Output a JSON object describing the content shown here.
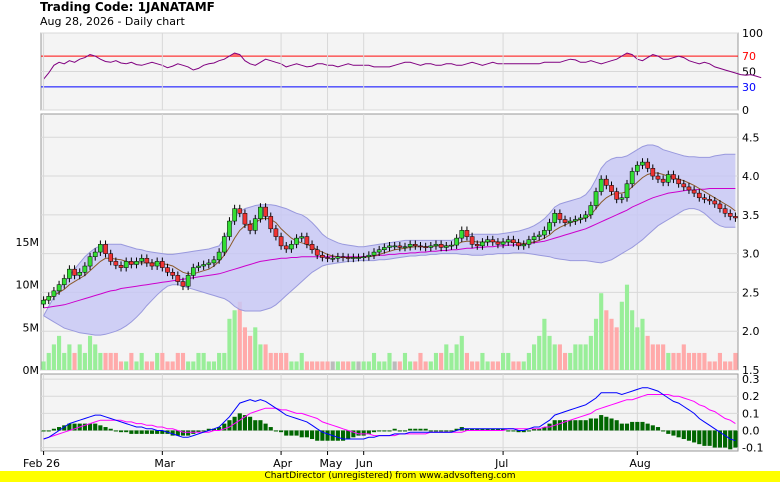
{
  "header": {
    "title": "Trading Code: 1JANATAMF",
    "subtitle": "Aug 28, 2026 - Daily chart"
  },
  "footer": {
    "text": "ChartDirector (unregistered) from www.advsofteng.com"
  },
  "colors": {
    "plot_bg": "#f4f4f4",
    "grid": "#d8d8d8",
    "rsi_line": "#800080",
    "rsi_upper": "#ff0000",
    "rsi_lower": "#0000ff",
    "rsi_fill_high": "#ff6666",
    "bb_fill": "#c8c8f4",
    "bb_edge": "#9999dd",
    "sma_fast": "#8b5a2b",
    "sma_slow": "#cc00cc",
    "candle_up": "#33dd33",
    "candle_down": "#ee3333",
    "volume_up": "#99ee99",
    "volume_down": "#ffaaaa",
    "volume_flat": "#bbbbbb",
    "macd_line": "#0000ff",
    "signal_line": "#ff00ff",
    "hist": "#006600",
    "footer_bg": "#ffff00"
  },
  "chart_data": [
    {
      "panel": "rsi",
      "type": "line",
      "y_ticks": [
        0,
        50,
        100
      ],
      "ylim": [
        0,
        100
      ],
      "reference_lines": [
        {
          "label": "70",
          "value": 70,
          "color": "#ff0000"
        },
        {
          "label": "30",
          "value": 30,
          "color": "#0000ff"
        }
      ],
      "values": [
        40,
        48,
        58,
        62,
        60,
        64,
        62,
        66,
        68,
        72,
        70,
        66,
        63,
        62,
        64,
        61,
        60,
        62,
        59,
        58,
        60,
        62,
        60,
        58,
        55,
        57,
        60,
        58,
        56,
        52,
        54,
        58,
        60,
        61,
        64,
        66,
        70,
        74,
        72,
        64,
        60,
        58,
        62,
        66,
        64,
        62,
        60,
        56,
        58,
        60,
        58,
        56,
        57,
        60,
        60,
        58,
        58,
        56,
        58,
        60,
        58,
        58,
        58,
        58,
        56,
        56,
        56,
        56,
        58,
        60,
        62,
        62,
        60,
        58,
        60,
        60,
        58,
        58,
        60,
        60,
        58,
        58,
        60,
        62,
        60,
        58,
        60,
        62,
        60,
        60,
        60,
        60,
        60,
        60,
        60,
        60,
        60,
        62,
        62,
        62,
        62,
        64,
        66,
        65,
        62,
        62,
        64,
        62,
        60,
        62,
        64,
        66,
        70,
        74,
        72,
        66,
        64,
        68,
        72,
        70,
        66,
        66,
        68,
        70,
        68,
        64,
        62,
        60,
        62,
        60,
        56,
        54,
        52,
        50,
        48,
        46,
        45,
        46,
        44,
        42
      ]
    },
    {
      "panel": "price",
      "type": "candlestick",
      "y_ticks": [
        1.5,
        2.0,
        2.5,
        3.0,
        3.5,
        4.0,
        4.5
      ],
      "ylim": [
        1.5,
        4.8
      ],
      "x_labels": [
        "Feb 26",
        "Mar",
        "Apr",
        "May",
        "Jun",
        "Jul",
        "Aug"
      ],
      "x_label_index": [
        0,
        23,
        46,
        55,
        62,
        89,
        115
      ],
      "volume_ticks": [
        "0M",
        "5M",
        "10M",
        "15M"
      ],
      "volume_tick_values": [
        0,
        5,
        10,
        15
      ],
      "volume_ylim": [
        0,
        30
      ],
      "close": [
        2.4,
        2.45,
        2.52,
        2.6,
        2.68,
        2.8,
        2.72,
        2.76,
        2.84,
        2.96,
        3.02,
        3.12,
        3.0,
        2.9,
        2.85,
        2.82,
        2.9,
        2.86,
        2.9,
        2.94,
        2.88,
        2.84,
        2.9,
        2.82,
        2.76,
        2.72,
        2.64,
        2.58,
        2.72,
        2.82,
        2.84,
        2.86,
        2.88,
        2.92,
        3.02,
        3.22,
        3.42,
        3.58,
        3.52,
        3.38,
        3.3,
        3.45,
        3.6,
        3.48,
        3.32,
        3.22,
        3.1,
        3.06,
        3.12,
        3.2,
        3.22,
        3.12,
        3.05,
        2.98,
        2.95,
        2.94,
        2.94,
        2.96,
        2.95,
        2.94,
        2.95,
        2.95,
        2.96,
        2.98,
        3.02,
        3.05,
        3.08,
        3.1,
        3.1,
        3.08,
        3.09,
        3.12,
        3.1,
        3.09,
        3.08,
        3.1,
        3.12,
        3.08,
        3.1,
        3.11,
        3.2,
        3.3,
        3.22,
        3.12,
        3.1,
        3.15,
        3.18,
        3.15,
        3.12,
        3.15,
        3.18,
        3.14,
        3.1,
        3.12,
        3.18,
        3.22,
        3.24,
        3.3,
        3.4,
        3.52,
        3.44,
        3.4,
        3.42,
        3.44,
        3.46,
        3.5,
        3.62,
        3.8,
        3.96,
        3.88,
        3.8,
        3.7,
        3.72,
        3.9,
        4.06,
        4.14,
        4.18,
        4.1,
        4.0,
        3.96,
        3.92,
        4.02,
        3.96,
        3.9,
        3.86,
        3.82,
        3.78,
        3.72,
        3.7,
        3.68,
        3.64,
        3.58,
        3.52,
        3.48,
        3.46
      ],
      "bb_upper": [
        2.2,
        2.32,
        2.44,
        2.54,
        2.62,
        2.72,
        2.8,
        2.88,
        2.96,
        3.02,
        3.07,
        3.1,
        3.12,
        3.12,
        3.12,
        3.12,
        3.1,
        3.08,
        3.06,
        3.05,
        3.03,
        3.02,
        3.01,
        3.0,
        2.99,
        2.99,
        3.0,
        3.01,
        3.02,
        3.03,
        3.04,
        3.05,
        3.06,
        3.08,
        3.1,
        3.2,
        3.33,
        3.45,
        3.54,
        3.58,
        3.6,
        3.62,
        3.63,
        3.63,
        3.63,
        3.62,
        3.6,
        3.58,
        3.55,
        3.52,
        3.5,
        3.46,
        3.4,
        3.33,
        3.25,
        3.2,
        3.17,
        3.14,
        3.12,
        3.11,
        3.1,
        3.09,
        3.09,
        3.1,
        3.11,
        3.12,
        3.13,
        3.14,
        3.15,
        3.16,
        3.17,
        3.17,
        3.17,
        3.17,
        3.17,
        3.17,
        3.17,
        3.17,
        3.17,
        3.17,
        3.19,
        3.22,
        3.24,
        3.25,
        3.25,
        3.25,
        3.25,
        3.25,
        3.25,
        3.26,
        3.27,
        3.28,
        3.29,
        3.31,
        3.33,
        3.36,
        3.4,
        3.45,
        3.52,
        3.6,
        3.64,
        3.66,
        3.68,
        3.7,
        3.72,
        3.76,
        3.84,
        3.96,
        4.1,
        4.18,
        4.22,
        4.24,
        4.24,
        4.26,
        4.3,
        4.34,
        4.38,
        4.4,
        4.4,
        4.38,
        4.34,
        4.32,
        4.3,
        4.28,
        4.26,
        4.25,
        4.25,
        4.24,
        4.24,
        4.24,
        4.26,
        4.27,
        4.28,
        4.28,
        4.28
      ],
      "bb_lower": [
        2.2,
        2.16,
        2.12,
        2.08,
        2.04,
        2.02,
        2.0,
        1.98,
        1.97,
        1.96,
        1.95,
        1.95,
        1.96,
        1.98,
        2.0,
        2.03,
        2.07,
        2.12,
        2.18,
        2.25,
        2.33,
        2.4,
        2.47,
        2.53,
        2.58,
        2.6,
        2.6,
        2.58,
        2.56,
        2.54,
        2.52,
        2.5,
        2.48,
        2.46,
        2.44,
        2.42,
        2.38,
        2.32,
        2.28,
        2.26,
        2.26,
        2.26,
        2.26,
        2.28,
        2.3,
        2.34,
        2.4,
        2.46,
        2.52,
        2.58,
        2.64,
        2.7,
        2.76,
        2.8,
        2.84,
        2.86,
        2.87,
        2.88,
        2.89,
        2.9,
        2.9,
        2.91,
        2.91,
        2.91,
        2.91,
        2.92,
        2.92,
        2.93,
        2.94,
        2.95,
        2.96,
        2.97,
        2.97,
        2.98,
        2.98,
        2.99,
        2.99,
        3.0,
        3.0,
        3.0,
        3.0,
        2.99,
        2.99,
        2.98,
        2.98,
        2.98,
        2.99,
        2.99,
        3.0,
        3.0,
        3.0,
        3.01,
        3.01,
        3.01,
        3.0,
        2.99,
        2.98,
        2.97,
        2.96,
        2.94,
        2.93,
        2.92,
        2.91,
        2.91,
        2.91,
        2.91,
        2.9,
        2.89,
        2.88,
        2.9,
        2.92,
        2.96,
        3.0,
        3.04,
        3.08,
        3.13,
        3.18,
        3.24,
        3.3,
        3.36,
        3.4,
        3.44,
        3.48,
        3.52,
        3.56,
        3.58,
        3.58,
        3.56,
        3.52,
        3.46,
        3.4,
        3.36,
        3.34,
        3.34,
        3.34
      ],
      "sma_fast": [
        2.4,
        2.42,
        2.46,
        2.5,
        2.54,
        2.6,
        2.64,
        2.68,
        2.72,
        2.78,
        2.84,
        2.9,
        2.94,
        2.94,
        2.93,
        2.92,
        2.9,
        2.88,
        2.88,
        2.88,
        2.88,
        2.88,
        2.88,
        2.87,
        2.86,
        2.84,
        2.8,
        2.76,
        2.74,
        2.74,
        2.76,
        2.78,
        2.8,
        2.84,
        2.9,
        2.98,
        3.08,
        3.2,
        3.3,
        3.36,
        3.38,
        3.4,
        3.44,
        3.46,
        3.44,
        3.4,
        3.32,
        3.26,
        3.2,
        3.16,
        3.14,
        3.12,
        3.09,
        3.05,
        3.02,
        2.99,
        2.97,
        2.96,
        2.95,
        2.95,
        2.95,
        2.95,
        2.95,
        2.96,
        2.97,
        2.99,
        3.01,
        3.03,
        3.05,
        3.06,
        3.07,
        3.08,
        3.09,
        3.09,
        3.09,
        3.09,
        3.1,
        3.1,
        3.1,
        3.1,
        3.12,
        3.15,
        3.16,
        3.16,
        3.15,
        3.15,
        3.15,
        3.16,
        3.15,
        3.15,
        3.15,
        3.15,
        3.14,
        3.13,
        3.14,
        3.15,
        3.17,
        3.2,
        3.24,
        3.3,
        3.34,
        3.37,
        3.4,
        3.42,
        3.44,
        3.46,
        3.5,
        3.58,
        3.66,
        3.72,
        3.76,
        3.78,
        3.78,
        3.8,
        3.86,
        3.92,
        3.98,
        4.02,
        4.04,
        4.04,
        4.02,
        4.0,
        3.98,
        3.96,
        3.94,
        3.91,
        3.88,
        3.84,
        3.8,
        3.76,
        3.72,
        3.68,
        3.64,
        3.6,
        3.55
      ],
      "sma_slow": [
        2.3,
        2.31,
        2.32,
        2.33,
        2.34,
        2.36,
        2.38,
        2.4,
        2.42,
        2.44,
        2.46,
        2.48,
        2.5,
        2.52,
        2.53,
        2.55,
        2.56,
        2.57,
        2.58,
        2.59,
        2.6,
        2.61,
        2.62,
        2.63,
        2.64,
        2.65,
        2.66,
        2.67,
        2.68,
        2.69,
        2.7,
        2.71,
        2.72,
        2.73,
        2.74,
        2.76,
        2.78,
        2.8,
        2.82,
        2.84,
        2.86,
        2.88,
        2.9,
        2.91,
        2.92,
        2.93,
        2.94,
        2.94,
        2.95,
        2.95,
        2.96,
        2.96,
        2.96,
        2.96,
        2.96,
        2.96,
        2.96,
        2.96,
        2.96,
        2.96,
        2.96,
        2.96,
        2.96,
        2.97,
        2.97,
        2.98,
        2.98,
        2.99,
        2.99,
        3.0,
        3.0,
        3.01,
        3.01,
        3.02,
        3.02,
        3.03,
        3.03,
        3.04,
        3.04,
        3.05,
        3.05,
        3.06,
        3.07,
        3.07,
        3.08,
        3.08,
        3.09,
        3.09,
        3.1,
        3.1,
        3.11,
        3.11,
        3.12,
        3.12,
        3.13,
        3.14,
        3.15,
        3.16,
        3.18,
        3.2,
        3.22,
        3.24,
        3.26,
        3.28,
        3.3,
        3.32,
        3.35,
        3.38,
        3.41,
        3.44,
        3.47,
        3.5,
        3.53,
        3.56,
        3.6,
        3.63,
        3.66,
        3.69,
        3.72,
        3.74,
        3.76,
        3.78,
        3.79,
        3.8,
        3.81,
        3.82,
        3.82,
        3.83,
        3.83,
        3.84,
        3.84,
        3.84,
        3.84,
        3.84,
        3.84
      ],
      "volume": [
        1,
        2,
        3,
        4,
        2,
        3,
        2,
        3,
        2,
        4,
        3,
        2,
        2,
        2,
        2,
        1,
        1,
        2,
        1,
        2,
        1,
        1,
        2,
        2,
        1,
        1,
        2,
        2,
        1,
        1,
        2,
        2,
        1,
        1,
        2,
        2,
        6,
        7,
        8,
        5,
        4,
        5,
        3,
        3,
        2,
        2,
        2,
        2,
        1,
        1,
        2,
        1,
        1,
        1,
        1,
        1,
        1,
        1,
        1,
        1,
        1,
        1,
        1,
        1,
        2,
        1,
        1,
        2,
        1,
        1,
        2,
        1,
        1,
        2,
        1,
        1,
        2,
        2,
        3,
        2,
        3,
        4,
        2,
        1,
        1,
        2,
        1,
        1,
        1,
        2,
        2,
        1,
        1,
        1,
        2,
        3,
        4,
        6,
        4,
        3,
        3,
        2,
        2,
        3,
        3,
        3,
        4,
        6,
        9,
        7,
        6,
        5,
        8,
        10,
        7,
        5,
        6,
        4,
        3,
        3,
        3,
        2,
        2,
        2,
        3,
        2,
        2,
        2,
        2,
        1,
        1,
        2,
        1,
        1,
        2
      ]
    },
    {
      "panel": "macd",
      "type": "line",
      "y_ticks": [
        -0.1,
        0.0,
        0.1,
        0.2,
        0.3
      ],
      "ylim": [
        -0.12,
        0.33
      ],
      "macd": [
        -0.05,
        -0.04,
        -0.02,
        0.0,
        0.02,
        0.04,
        0.05,
        0.06,
        0.07,
        0.08,
        0.09,
        0.09,
        0.08,
        0.07,
        0.06,
        0.05,
        0.04,
        0.03,
        0.02,
        0.02,
        0.01,
        0.01,
        0.0,
        0.0,
        -0.01,
        -0.02,
        -0.03,
        -0.04,
        -0.04,
        -0.03,
        -0.02,
        -0.01,
        0.0,
        0.01,
        0.02,
        0.05,
        0.08,
        0.12,
        0.16,
        0.17,
        0.18,
        0.17,
        0.18,
        0.17,
        0.15,
        0.13,
        0.11,
        0.09,
        0.08,
        0.07,
        0.06,
        0.05,
        0.03,
        0.01,
        -0.01,
        -0.02,
        -0.03,
        -0.04,
        -0.05,
        -0.05,
        -0.05,
        -0.05,
        -0.05,
        -0.04,
        -0.04,
        -0.03,
        -0.03,
        -0.03,
        -0.02,
        -0.02,
        -0.02,
        -0.01,
        -0.01,
        -0.01,
        -0.01,
        -0.01,
        -0.01,
        -0.01,
        -0.01,
        -0.01,
        0.0,
        0.01,
        0.01,
        0.01,
        0.01,
        0.01,
        0.01,
        0.01,
        0.01,
        0.01,
        0.01,
        0.01,
        0.0,
        0.0,
        0.01,
        0.02,
        0.02,
        0.04,
        0.06,
        0.09,
        0.1,
        0.11,
        0.12,
        0.13,
        0.14,
        0.15,
        0.17,
        0.19,
        0.22,
        0.22,
        0.22,
        0.22,
        0.21,
        0.22,
        0.23,
        0.24,
        0.25,
        0.25,
        0.24,
        0.23,
        0.21,
        0.19,
        0.17,
        0.16,
        0.14,
        0.12,
        0.1,
        0.07,
        0.05,
        0.03,
        0.01,
        -0.01,
        -0.03,
        -0.05,
        -0.06
      ],
      "signal": [
        -0.05,
        -0.04,
        -0.03,
        -0.02,
        -0.01,
        0.0,
        0.01,
        0.02,
        0.03,
        0.04,
        0.05,
        0.06,
        0.06,
        0.06,
        0.06,
        0.06,
        0.05,
        0.05,
        0.04,
        0.04,
        0.03,
        0.03,
        0.02,
        0.02,
        0.01,
        0.01,
        0.0,
        -0.01,
        -0.01,
        -0.01,
        -0.01,
        -0.01,
        -0.01,
        0.0,
        0.0,
        0.01,
        0.02,
        0.04,
        0.06,
        0.08,
        0.1,
        0.11,
        0.12,
        0.13,
        0.13,
        0.13,
        0.12,
        0.12,
        0.11,
        0.1,
        0.1,
        0.09,
        0.08,
        0.07,
        0.05,
        0.04,
        0.03,
        0.02,
        0.01,
        0.0,
        -0.01,
        -0.02,
        -0.02,
        -0.02,
        -0.03,
        -0.03,
        -0.03,
        -0.03,
        -0.03,
        -0.02,
        -0.02,
        -0.02,
        -0.02,
        -0.02,
        -0.02,
        -0.01,
        -0.01,
        -0.01,
        -0.01,
        -0.01,
        -0.01,
        -0.01,
        0.0,
        0.0,
        0.0,
        0.0,
        0.0,
        0.0,
        0.0,
        0.0,
        0.01,
        0.01,
        0.01,
        0.01,
        0.01,
        0.01,
        0.01,
        0.02,
        0.02,
        0.03,
        0.04,
        0.05,
        0.06,
        0.07,
        0.08,
        0.09,
        0.1,
        0.12,
        0.13,
        0.14,
        0.15,
        0.16,
        0.17,
        0.18,
        0.18,
        0.19,
        0.2,
        0.21,
        0.21,
        0.21,
        0.21,
        0.21,
        0.2,
        0.2,
        0.19,
        0.18,
        0.17,
        0.15,
        0.14,
        0.12,
        0.11,
        0.09,
        0.07,
        0.06,
        0.04
      ]
    }
  ]
}
